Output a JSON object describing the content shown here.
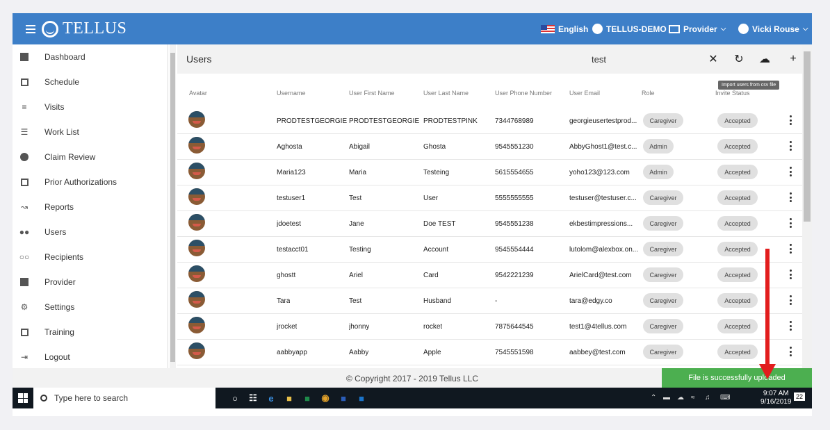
{
  "topbar": {
    "logo_text": "TELLUS",
    "language": "English",
    "tenant": "TELLUS-DEMO",
    "role_menu": "Provider",
    "user_menu": "Vicki Rouse"
  },
  "sidebar": {
    "items": [
      {
        "label": "Dashboard",
        "icon": "dashboard-icon"
      },
      {
        "label": "Schedule",
        "icon": "calendar-icon"
      },
      {
        "label": "Visits",
        "icon": "filter-icon"
      },
      {
        "label": "Work List",
        "icon": "list-icon"
      },
      {
        "label": "Claim Review",
        "icon": "alert-icon"
      },
      {
        "label": "Prior Authorizations",
        "icon": "calendar-icon"
      },
      {
        "label": "Reports",
        "icon": "trend-icon"
      },
      {
        "label": "Users",
        "icon": "users-icon"
      },
      {
        "label": "Recipients",
        "icon": "group-icon"
      },
      {
        "label": "Provider",
        "icon": "clipboard-icon"
      },
      {
        "label": "Settings",
        "icon": "gear-icon"
      },
      {
        "label": "Training",
        "icon": "training-icon"
      },
      {
        "label": "Logout",
        "icon": "logout-icon"
      }
    ]
  },
  "main": {
    "title": "Users",
    "search_value": "test",
    "tooltip": "Import users from csv file",
    "columns": [
      "Avatar",
      "Username",
      "User First Name",
      "User Last Name",
      "User Phone Number",
      "User Email",
      "Role",
      "Invite Status"
    ],
    "rows": [
      {
        "username": "PRODTESTGEORGIE",
        "first": "PRODTESTGEORGIE",
        "last": "PRODTESTPINK",
        "phone": "7344768989",
        "email": "georgieusertestprod...",
        "role": "Caregiver",
        "status": "Accepted"
      },
      {
        "username": "Aghosta",
        "first": "Abigail",
        "last": "Ghosta",
        "phone": "9545551230",
        "email": "AbbyGhost1@test.c...",
        "role": "Admin",
        "status": "Accepted"
      },
      {
        "username": "Maria123",
        "first": "Maria",
        "last": "Testeing",
        "phone": "5615554655",
        "email": "yoho123@123.com",
        "role": "Admin",
        "status": "Accepted"
      },
      {
        "username": "testuser1",
        "first": "Test",
        "last": "User",
        "phone": "5555555555",
        "email": "testuser@testuser.c...",
        "role": "Caregiver",
        "status": "Accepted"
      },
      {
        "username": "jdoetest",
        "first": "Jane",
        "last": "Doe TEST",
        "phone": "9545551238",
        "email": "ekbestimpressions...",
        "role": "Caregiver",
        "status": "Accepted"
      },
      {
        "username": "testacct01",
        "first": "Testing",
        "last": "Account",
        "phone": "9545554444",
        "email": "lutolom@alexbox.on...",
        "role": "Caregiver",
        "status": "Accepted"
      },
      {
        "username": "ghostt",
        "first": "Ariel",
        "last": "Card",
        "phone": "9542221239",
        "email": "ArielCard@test.com",
        "role": "Caregiver",
        "status": "Accepted"
      },
      {
        "username": "Tara",
        "first": "Test",
        "last": "Husband",
        "phone": "-",
        "email": "tara@edgy.co",
        "role": "Caregiver",
        "status": "Accepted"
      },
      {
        "username": "jrocket",
        "first": "jhonny",
        "last": "rocket",
        "phone": "7875644545",
        "email": "test1@4tellus.com",
        "role": "Caregiver",
        "status": "Accepted"
      },
      {
        "username": "aabbyapp",
        "first": "Aabby",
        "last": "Apple",
        "phone": "7545551598",
        "email": "aabbey@test.com",
        "role": "Caregiver",
        "status": "Accepted"
      }
    ]
  },
  "footer": {
    "copyright": "© Copyright 2017 - 2019 Tellus LLC",
    "toast": "File is successfully uploaded"
  },
  "taskbar": {
    "search_placeholder": "Type here to search",
    "time": "9:07 AM",
    "date": "9/16/2019",
    "notifications": "22"
  },
  "colors": {
    "brand": "#3d7fc8",
    "toast": "#4caf50",
    "arrow": "#e21d1d"
  }
}
